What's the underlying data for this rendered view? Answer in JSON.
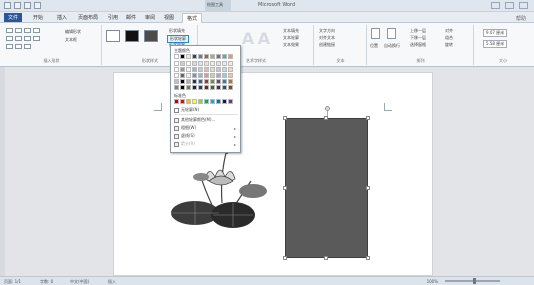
{
  "title_bar": {
    "window_title": "Microsoft Word",
    "context_label": "绘图工具"
  },
  "tabs": [
    "文件",
    "开始",
    "插入",
    "页面布局",
    "引用",
    "邮件",
    "审阅",
    "视图",
    "格式"
  ],
  "help": "帮助",
  "ribbon": {
    "insert_shapes": {
      "edit_shape": "编辑形状",
      "text_box": "文本框",
      "label": "插入形状"
    },
    "shape_styles": {
      "fill": "形状填充",
      "outline": "形状轮廓",
      "effects": "形状效果",
      "label": "形状样式"
    },
    "wordart": {
      "label": "艺术字样式",
      "text_fill": "文本填充",
      "text_outline": "文本轮廓",
      "text_effects": "文本效果"
    },
    "text": {
      "direction": "文字方向",
      "align": "对齐文本",
      "link": "创建链接",
      "label": "文本"
    },
    "arrange": {
      "position": "位置",
      "wrap": "自动换行",
      "forward": "上移一层",
      "backward": "下移一层",
      "pane": "选择窗格",
      "align": "对齐",
      "group": "组合",
      "rotate": "旋转",
      "label": "排列"
    },
    "size": {
      "height": "9.07 厘米",
      "width": "5.58 厘米",
      "label": "大小"
    }
  },
  "outline_dropdown": {
    "theme_colors_title": "主题颜色",
    "standard_colors_title": "标准色",
    "no_outline": "无轮廓(N)",
    "more_colors": "其他轮廓颜色(M)...",
    "weight": "粗细(W)",
    "dashes": "虚线(S)",
    "arrows": "箭头(R)"
  },
  "status": {
    "page": "页面: 1/1",
    "words": "字数: 0",
    "lang": "中文(中国)",
    "insert": "插入",
    "zoom": "100%"
  },
  "colors": {
    "file_tab": "#2b579a",
    "highlight": "#1a8fe3",
    "shape_fill": "#5a5a5a",
    "theme_colors": [
      "#ffffff",
      "#000000",
      "#eeece1",
      "#1f497d",
      "#4f81bd",
      "#c0504d",
      "#9bbb59",
      "#8064a2",
      "#4bacc6",
      "#f79646"
    ],
    "standard_colors": [
      "#c00000",
      "#ff0000",
      "#ffc000",
      "#ffff00",
      "#92d050",
      "#00b050",
      "#00b0f0",
      "#0070c0",
      "#002060",
      "#7030a0"
    ]
  },
  "icons": [
    "quick-access-icons",
    "text-box-icon",
    "shape-preset-icon",
    "outline-pen-icon",
    "no-outline-icon",
    "more-colors-icon",
    "weight-icon",
    "dashes-icon",
    "arrows-icon",
    "lotus-image-icon"
  ]
}
